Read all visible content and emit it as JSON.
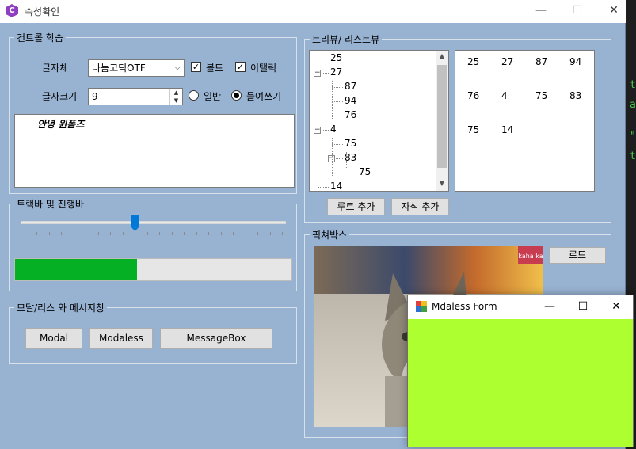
{
  "window": {
    "title": "속성확인",
    "min_glyph": "—",
    "max_glyph": "☐",
    "close_glyph": "✕"
  },
  "control_group": {
    "title": "컨트롤 학습",
    "font_label": "글자체",
    "font_value": "나눔고딕OTF",
    "bold_label": "볼드",
    "bold_checked": true,
    "italic_label": "이탤릭",
    "italic_checked": true,
    "size_label": "글자크기",
    "size_value": "9",
    "normal_label": "일반",
    "indent_label": "들여쓰기",
    "selected_style": "들여쓰기",
    "text_content": "안녕 윈폼즈"
  },
  "track_group": {
    "title": "트랙바 및 진행바",
    "trackbar_value": 0.43,
    "tick_count": 22,
    "progress_value": 0.44,
    "progress_color": "#06b025"
  },
  "modal_group": {
    "title": "모달/리스 와 메시지창",
    "buttons": [
      "Modal",
      "Modaless",
      "MessageBox"
    ]
  },
  "tree_group": {
    "title": "트리뷰/ 리스트뷰",
    "tree_items": [
      {
        "label": "25",
        "level": 0,
        "toggle": ""
      },
      {
        "label": "27",
        "level": 0,
        "toggle": "−"
      },
      {
        "label": "87",
        "level": 1,
        "toggle": ""
      },
      {
        "label": "94",
        "level": 1,
        "toggle": ""
      },
      {
        "label": "76",
        "level": 1,
        "toggle": ""
      },
      {
        "label": "4",
        "level": 0,
        "toggle": "−"
      },
      {
        "label": "75",
        "level": 1,
        "toggle": ""
      },
      {
        "label": "83",
        "level": 1,
        "toggle": "−"
      },
      {
        "label": "75",
        "level": 2,
        "toggle": ""
      },
      {
        "label": "14",
        "level": 0,
        "toggle": ""
      }
    ],
    "list_rows": [
      [
        "25",
        "27",
        "87",
        "94"
      ],
      [
        "76",
        "4",
        "75",
        "83"
      ],
      [
        "75",
        "14"
      ]
    ],
    "add_root_label": "루트 추가",
    "add_child_label": "자식 추가"
  },
  "picture_group": {
    "title": "픽쳐박스",
    "load_label": "로드",
    "sign_text": "kaha ka"
  },
  "child_window": {
    "title": "Mdaless Form",
    "background": "#adff2f"
  }
}
